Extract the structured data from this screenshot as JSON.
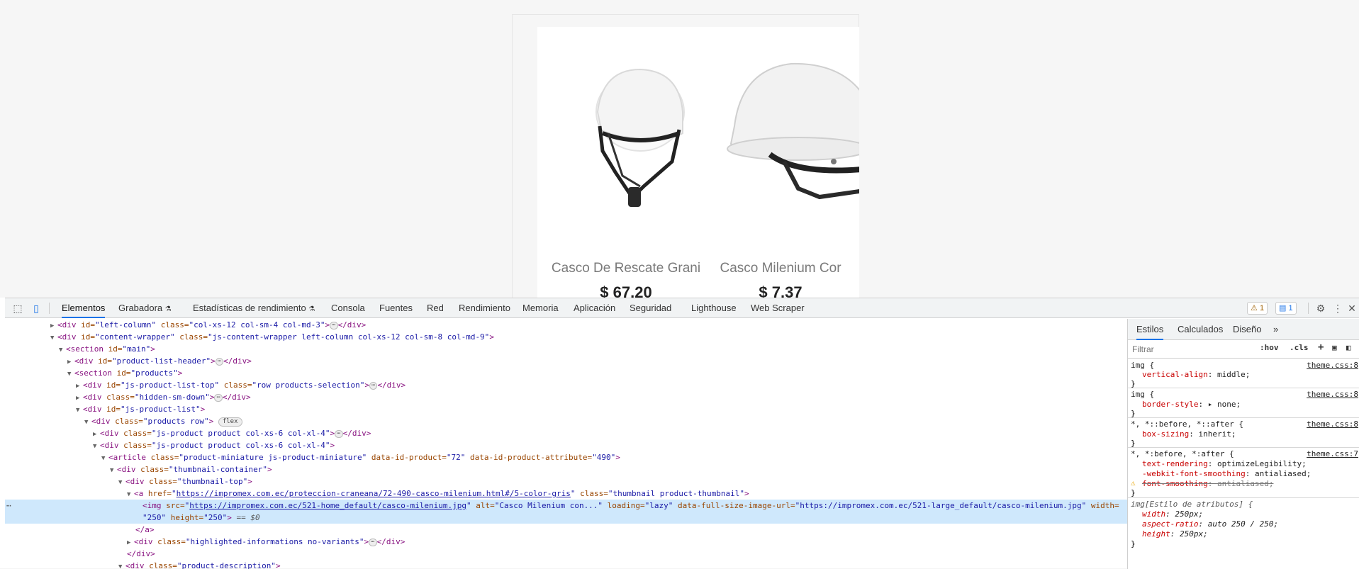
{
  "page": {
    "products": [
      {
        "name": "Casco De Rescate Grani",
        "price": "$ 67.20"
      },
      {
        "name": "Casco Milenium Cor",
        "price": "$ 7.37"
      }
    ]
  },
  "toolbar": {
    "tabs": [
      "Elementos",
      "Grabadora",
      "Estadísticas de rendimiento",
      "Consola",
      "Fuentes",
      "Red",
      "Rendimiento",
      "Memoria",
      "Aplicación",
      "Seguridad",
      "Lighthouse",
      "Web Scraper"
    ],
    "warnings": "1",
    "messages": "1"
  },
  "dom": {
    "l1": {
      "tag": "<div ",
      "a1": "id=",
      "v1": "\"left-column\"",
      "a2": " class=",
      "v2": "\"col-xs-12 col-sm-4 col-md-3\"",
      "end": "</div>"
    },
    "l2": {
      "tag": "<div ",
      "a1": "id=",
      "v1": "\"content-wrapper\"",
      "a2": " class=",
      "v2": "\"js-content-wrapper left-column col-xs-12 col-sm-8 col-md-9\"",
      "end": ">"
    },
    "l3": {
      "tag": "<section ",
      "a1": "id=",
      "v1": "\"main\"",
      "end": ">"
    },
    "l4": {
      "tag": "<div ",
      "a1": "id=",
      "v1": "\"product-list-header\"",
      "end": "</div>"
    },
    "l5": {
      "tag": "<section ",
      "a1": "id=",
      "v1": "\"products\"",
      "end": ">"
    },
    "l6": {
      "tag": "<div ",
      "a1": "id=",
      "v1": "\"js-product-list-top\"",
      "a2": " class=",
      "v2": "\"row products-selection\"",
      "end": "</div>"
    },
    "l7": {
      "tag": "<div ",
      "a1": "class=",
      "v1": "\"hidden-sm-down\"",
      "end": "</div>"
    },
    "l8": {
      "tag": "<div ",
      "a1": "id=",
      "v1": "\"js-product-list\"",
      "end": ">"
    },
    "l9": {
      "tag": "<div ",
      "a1": "class=",
      "v1": "\"products row\"",
      "end": ">",
      "pill": "flex"
    },
    "l10": {
      "tag": "<div ",
      "a1": "class=",
      "v1": "\"js-product product col-xs-6 col-xl-4\"",
      "end": "</div>"
    },
    "l11": {
      "tag": "<div ",
      "a1": "class=",
      "v1": "\"js-product product col-xs-6 col-xl-4\"",
      "end": ">"
    },
    "l12": {
      "tag": "<article ",
      "a1": "class=",
      "v1": "\"product-miniature js-product-miniature\"",
      "a2": " data-id-product=",
      "v2": "\"72\"",
      "a3": " data-id-product-attribute=",
      "v3": "\"490\"",
      "end": ">"
    },
    "l13": {
      "tag": "<div ",
      "a1": "class=",
      "v1": "\"thumbnail-container\"",
      "end": ">"
    },
    "l14": {
      "tag": "<div ",
      "a1": "class=",
      "v1": "\"thumbnail-top\"",
      "end": ">"
    },
    "l15": {
      "tag": "<a ",
      "a1": "href=",
      "q": "\"",
      "link": "https://impromex.com.ec/proteccion-craneana/72-490-casco-milenium.html#/5-color-gris",
      "a2": " class=",
      "v2": "\"thumbnail product-thumbnail\"",
      "end": ">"
    },
    "l16": {
      "tag": "<img ",
      "a1": "src=",
      "link": "https://impromex.com.ec/521-home_default/casco-milenium.jpg",
      "a2": " alt=",
      "v2": "\"Casco Milenium con...\"",
      "a3": " loading=",
      "v3": "\"lazy\"",
      "a4": " data-full-size-image-url=",
      "v4": "\"https://impromex.com.ec/521-large_default/casco-milenium.jpg\"",
      "a5": " width="
    },
    "l16b": {
      "v5": "\"250\"",
      "a6": " height=",
      "v6": "\"250\"",
      "end": ">",
      "eq": " == $0"
    },
    "l17": {
      "tag": "</a>"
    },
    "l18": {
      "tag": "<div ",
      "a1": "class=",
      "v1": "\"highlighted-informations no-variants\"",
      "end": "</div>"
    },
    "l19": {
      "tag": "</div>"
    },
    "l20": {
      "tag": "<div ",
      "a1": "class=",
      "v1": "\"product-description\"",
      "end": ">"
    }
  },
  "styles": {
    "tabs": [
      "Estilos",
      "Calculados",
      "Diseño"
    ],
    "filter_placeholder": "Filtrar",
    "hov": ":hov",
    "cls": ".cls",
    "rules": [
      {
        "selector": "img {",
        "source": "theme.css:8",
        "props": [
          [
            "vertical-align",
            "middle;"
          ]
        ]
      },
      {
        "selector": "img {",
        "source": "theme.css:8",
        "props": [
          [
            "border-style",
            "▸ none;"
          ]
        ]
      },
      {
        "selector": "*, *::before, *::after {",
        "source": "theme.css:8",
        "props": [
          [
            "box-sizing",
            "inherit;"
          ]
        ]
      },
      {
        "selector": "*, *:before, *:after {",
        "source": "theme.css:7",
        "props": [
          [
            "text-rendering",
            "optimizeLegibility;"
          ],
          [
            "-webkit-font-smoothing",
            "antialiased;"
          ],
          [
            "font-smoothing",
            "antialiased;"
          ]
        ]
      },
      {
        "selector": "img[Estilo de atributos] {",
        "source": "",
        "props": [
          [
            "width",
            "250px;"
          ],
          [
            "aspect-ratio",
            "auto 250 / 250;"
          ],
          [
            "height",
            "250px;"
          ]
        ]
      }
    ],
    "close_brace": "}"
  }
}
